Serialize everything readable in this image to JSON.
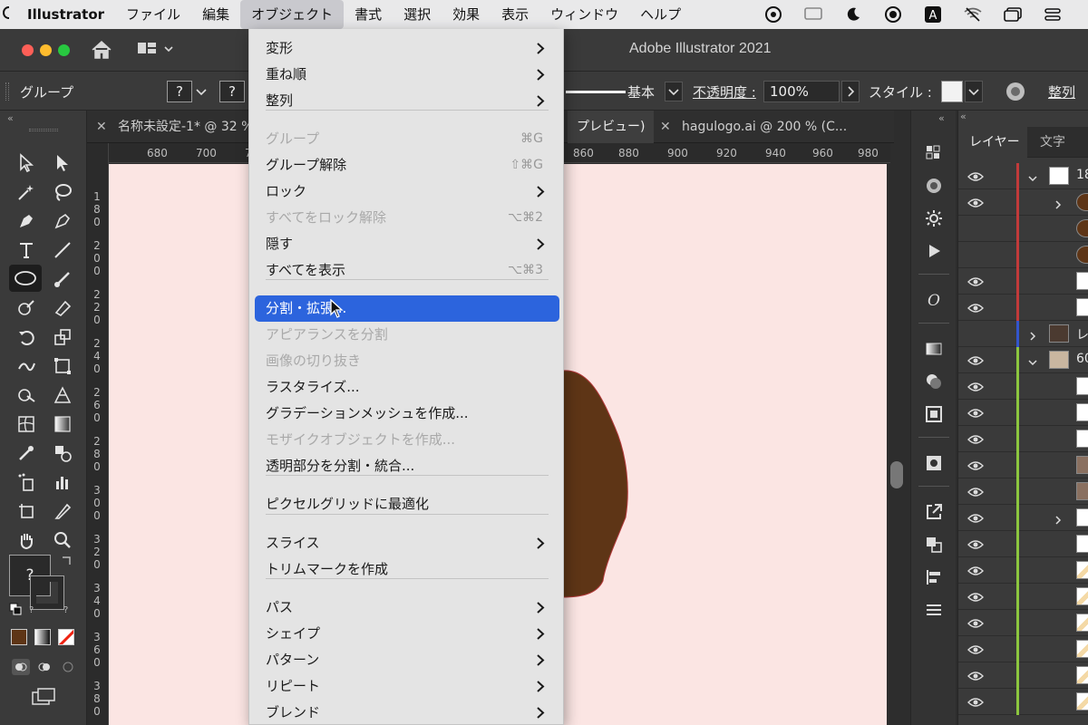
{
  "menubar": {
    "apple": "",
    "items": [
      "Illustrator",
      "ファイル",
      "編集",
      "オブジェクト",
      "書式",
      "選択",
      "効果",
      "表示",
      "ウィンドウ",
      "ヘルプ"
    ]
  },
  "window": {
    "title": "Adobe Illustrator 2021"
  },
  "controlbar": {
    "selection_label": "グループ",
    "fill_placeholder": "?",
    "stroke_placeholder": "?",
    "stroke_style": "基本",
    "opacity_label": "不透明度 :",
    "opacity_value": "100%",
    "style_label": "スタイル :",
    "align_label": "整列"
  },
  "tabs": {
    "tab1": "名称未設定-1* @ 32 %",
    "tab2": "プレビュー)",
    "tab3": "hagulogo.ai @ 200 % (C..."
  },
  "hruler": [
    "680",
    "700",
    "7",
    "860",
    "880",
    "900",
    "920",
    "940",
    "960",
    "980"
  ],
  "vruler": [
    "180",
    "200",
    "220",
    "240",
    "260",
    "280",
    "300",
    "320",
    "340",
    "360",
    "380"
  ],
  "object_menu": {
    "items": [
      {
        "label": "変形",
        "submenu": true
      },
      {
        "label": "重ね順",
        "submenu": true
      },
      {
        "label": "整列",
        "submenu": true
      },
      {
        "label": "グループ",
        "shortcut": "⌘G",
        "disabled": true
      },
      {
        "label": "グループ解除",
        "shortcut": "⇧⌘G"
      },
      {
        "label": "ロック",
        "submenu": true
      },
      {
        "label": "すべてをロック解除",
        "shortcut": "⌥⌘2",
        "disabled": true
      },
      {
        "label": "隠す",
        "submenu": true
      },
      {
        "label": "すべてを表示",
        "shortcut": "⌥⌘3"
      },
      {
        "label": "分割・拡張...",
        "highlighted": true
      },
      {
        "label": "アピアランスを分割",
        "disabled": true
      },
      {
        "label": "画像の切り抜き",
        "disabled": true
      },
      {
        "label": "ラスタライズ..."
      },
      {
        "label": "グラデーションメッシュを作成..."
      },
      {
        "label": "モザイクオブジェクトを作成...",
        "disabled": true
      },
      {
        "label": "透明部分を分割・統合..."
      },
      {
        "label": "ピクセルグリッドに最適化"
      },
      {
        "label": "スライス",
        "submenu": true
      },
      {
        "label": "トリムマークを作成"
      },
      {
        "label": "パス",
        "submenu": true
      },
      {
        "label": "シェイプ",
        "submenu": true
      },
      {
        "label": "パターン",
        "submenu": true
      },
      {
        "label": "リピート",
        "submenu": true
      },
      {
        "label": "ブレンド",
        "submenu": true
      }
    ]
  },
  "layers_panel": {
    "tab_layers": "レイヤー",
    "tab_text": "文字",
    "row_labels": [
      "18",
      "レ",
      "60"
    ]
  },
  "colors": {
    "accent": "#2c64dd",
    "canvas": "#fbe5e3",
    "shape_fill": "#5e3516",
    "layer_red": "#c23a3a",
    "layer_blue": "#3355cc",
    "layer_green": "#8cc63f"
  },
  "icons": {
    "pointer": "arrow-cursor",
    "home": "home-icon"
  }
}
